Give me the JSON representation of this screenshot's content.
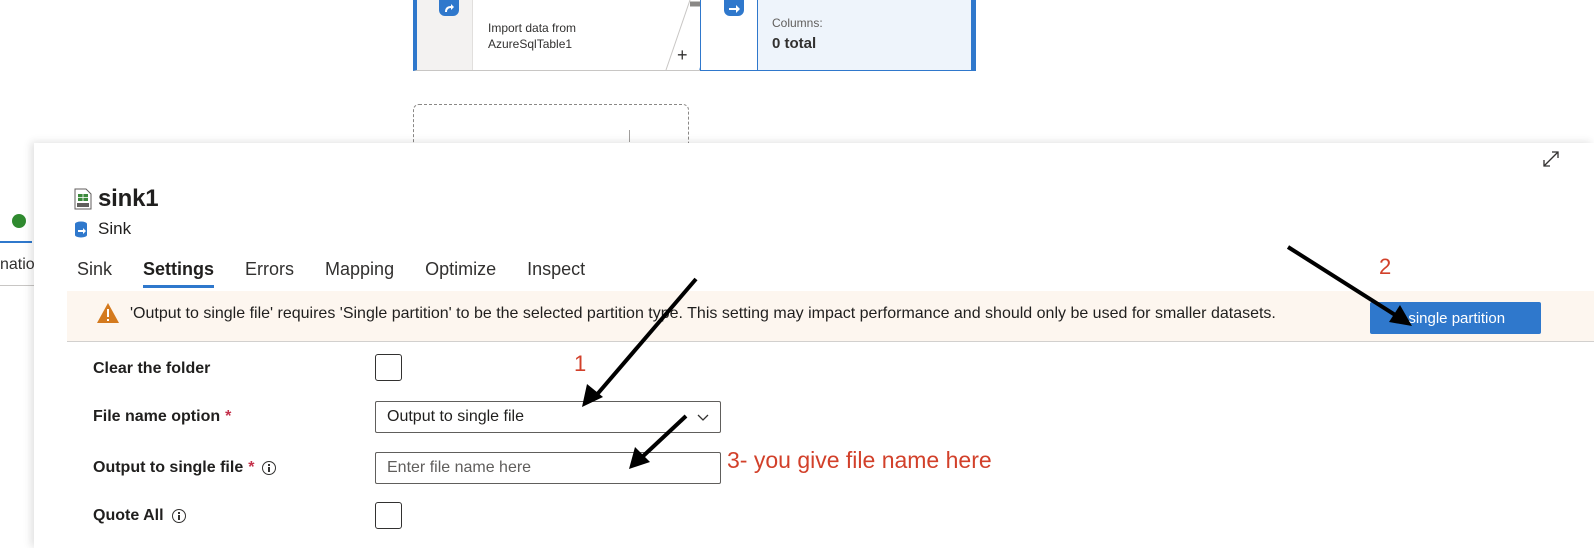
{
  "canvas": {
    "import_node": {
      "line1": "Import data from",
      "line2": "AzureSqlTable1"
    },
    "sink_node": {
      "columns_label": "Columns:",
      "columns_value": "0 total"
    },
    "plus_label": "+"
  },
  "left_stub": {
    "text": "natio"
  },
  "panel": {
    "title": "sink1",
    "subtitle": "Sink",
    "tabs": [
      {
        "label": "Sink",
        "active": false
      },
      {
        "label": "Settings",
        "active": true
      },
      {
        "label": "Errors",
        "active": false
      },
      {
        "label": "Mapping",
        "active": false
      },
      {
        "label": "Optimize",
        "active": false
      },
      {
        "label": "Inspect",
        "active": false
      }
    ],
    "warning": {
      "text": "'Output to single file' requires 'Single partition' to be the selected partition type. This setting may impact performance and should only be used for smaller datasets.",
      "button_label": "t single partition"
    },
    "form": {
      "clear_folder_label": "Clear the folder",
      "file_name_option_label": "File name option",
      "file_name_option_value": "Output to single file",
      "output_single_file_label": "Output to single file",
      "output_single_file_placeholder": "Enter file name here",
      "quote_all_label": "Quote All",
      "required_mark": "*"
    }
  },
  "annotations": {
    "label_1": "1",
    "label_2": "2",
    "label_3": "3- you give file name here",
    "color": "#d2402a"
  },
  "colors": {
    "accent": "#2f78cc",
    "warning_bg": "#fdf6ef",
    "warning_icon": "#d47a1e",
    "required": "#c4314b"
  }
}
